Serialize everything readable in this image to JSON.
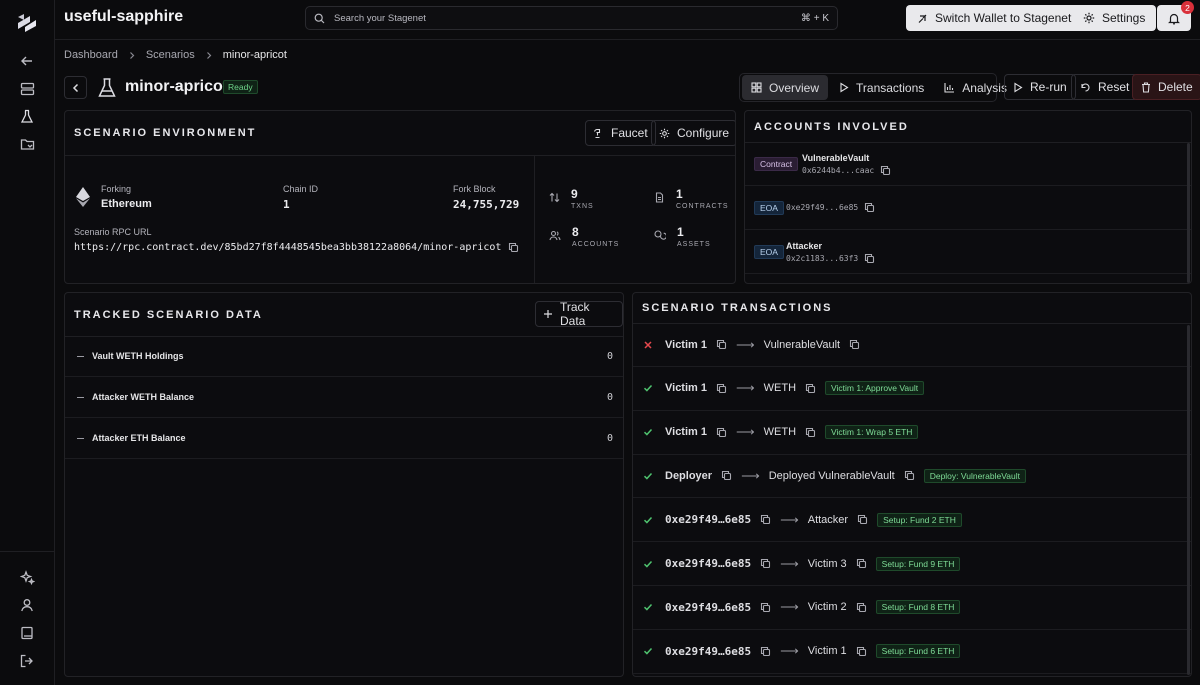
{
  "app": {
    "title": "useful-sapphire",
    "search": {
      "placeholder": "Search your Stagenet",
      "shortcut": "⌘ + K"
    },
    "buttons": {
      "switch_wallet": "Switch Wallet to Stagenet",
      "settings": "Settings"
    },
    "notifications": {
      "count": "2"
    }
  },
  "rail": {
    "top_icons": [
      "back-arrow-icon",
      "layers-icon",
      "flask-icon",
      "folder-icon"
    ],
    "bottom_icons": [
      "sparkle-icon",
      "user-icon",
      "book-icon",
      "logout-icon"
    ]
  },
  "breadcrumb": [
    "Dashboard",
    "Scenarios",
    "minor-apricot"
  ],
  "scenario": {
    "name": "minor-apricot",
    "status": "Ready",
    "tabs": [
      "Overview",
      "Transactions",
      "Analysis"
    ],
    "active_tab": "Overview",
    "actions": {
      "rerun": "Re-run",
      "reset": "Reset",
      "delete": "Delete"
    }
  },
  "environment": {
    "title": "SCENARIO ENVIRONMENT",
    "faucet": "Faucet",
    "configure": "Configure",
    "forking_label": "Forking",
    "forking_value": "Ethereum",
    "chain_label": "Chain ID",
    "chain_value": "1",
    "fork_label": "Fork Block",
    "fork_value": "24,755,729",
    "rpc_label": "Scenario RPC URL",
    "rpc_value": "https://rpc.contract.dev/85bd27f8f4448545bea3bb38122a8064/minor-apricot",
    "stats": [
      {
        "value": "9",
        "label": "TXNS",
        "icon": "swap-icon"
      },
      {
        "value": "1",
        "label": "CONTRACTS",
        "icon": "file-icon"
      },
      {
        "value": "8",
        "label": "ACCOUNTS",
        "icon": "users-icon"
      },
      {
        "value": "1",
        "label": "ASSETS",
        "icon": "coins-icon"
      }
    ]
  },
  "accounts": {
    "title": "ACCOUNTS INVOLVED",
    "items": [
      {
        "type": "Contract",
        "name": "VulnerableVault",
        "address": "0x6244b4...caac"
      },
      {
        "type": "EOA",
        "name": "",
        "address": "0xe29f49...6e85"
      },
      {
        "type": "EOA",
        "name": "Attacker",
        "address": "0x2c1183...63f3"
      }
    ]
  },
  "tracked": {
    "title": "TRACKED SCENARIO DATA",
    "button": "Track Data",
    "rows": [
      {
        "name": "Vault WETH Holdings",
        "value": "0"
      },
      {
        "name": "Attacker WETH Balance",
        "value": "0"
      },
      {
        "name": "Attacker ETH Balance",
        "value": "0"
      }
    ]
  },
  "transactions": {
    "title": "SCENARIO TRANSACTIONS",
    "rows": [
      {
        "status": "failed",
        "from": "Victim 1",
        "from_mono": false,
        "to": "VulnerableVault",
        "tag": ""
      },
      {
        "status": "success",
        "from": "Victim 1",
        "from_mono": false,
        "to": "WETH",
        "tag": "Victim 1: Approve Vault"
      },
      {
        "status": "success",
        "from": "Victim 1",
        "from_mono": false,
        "to": "WETH",
        "tag": "Victim 1: Wrap 5 ETH"
      },
      {
        "status": "success",
        "from": "Deployer",
        "from_mono": false,
        "to": "Deployed VulnerableVault",
        "tag": "Deploy: VulnerableVault"
      },
      {
        "status": "success",
        "from": "0xe29f49…6e85",
        "from_mono": true,
        "to": "Attacker",
        "tag": "Setup: Fund 2 ETH"
      },
      {
        "status": "success",
        "from": "0xe29f49…6e85",
        "from_mono": true,
        "to": "Victim 3",
        "tag": "Setup: Fund 9 ETH"
      },
      {
        "status": "success",
        "from": "0xe29f49…6e85",
        "from_mono": true,
        "to": "Victim 2",
        "tag": "Setup: Fund 8 ETH"
      },
      {
        "status": "success",
        "from": "0xe29f49…6e85",
        "from_mono": true,
        "to": "Victim 1",
        "tag": "Setup: Fund 6 ETH"
      }
    ]
  },
  "colors": {
    "success": "#4fc36f",
    "failed": "#e5484d",
    "accent": "#e9e9ec"
  }
}
